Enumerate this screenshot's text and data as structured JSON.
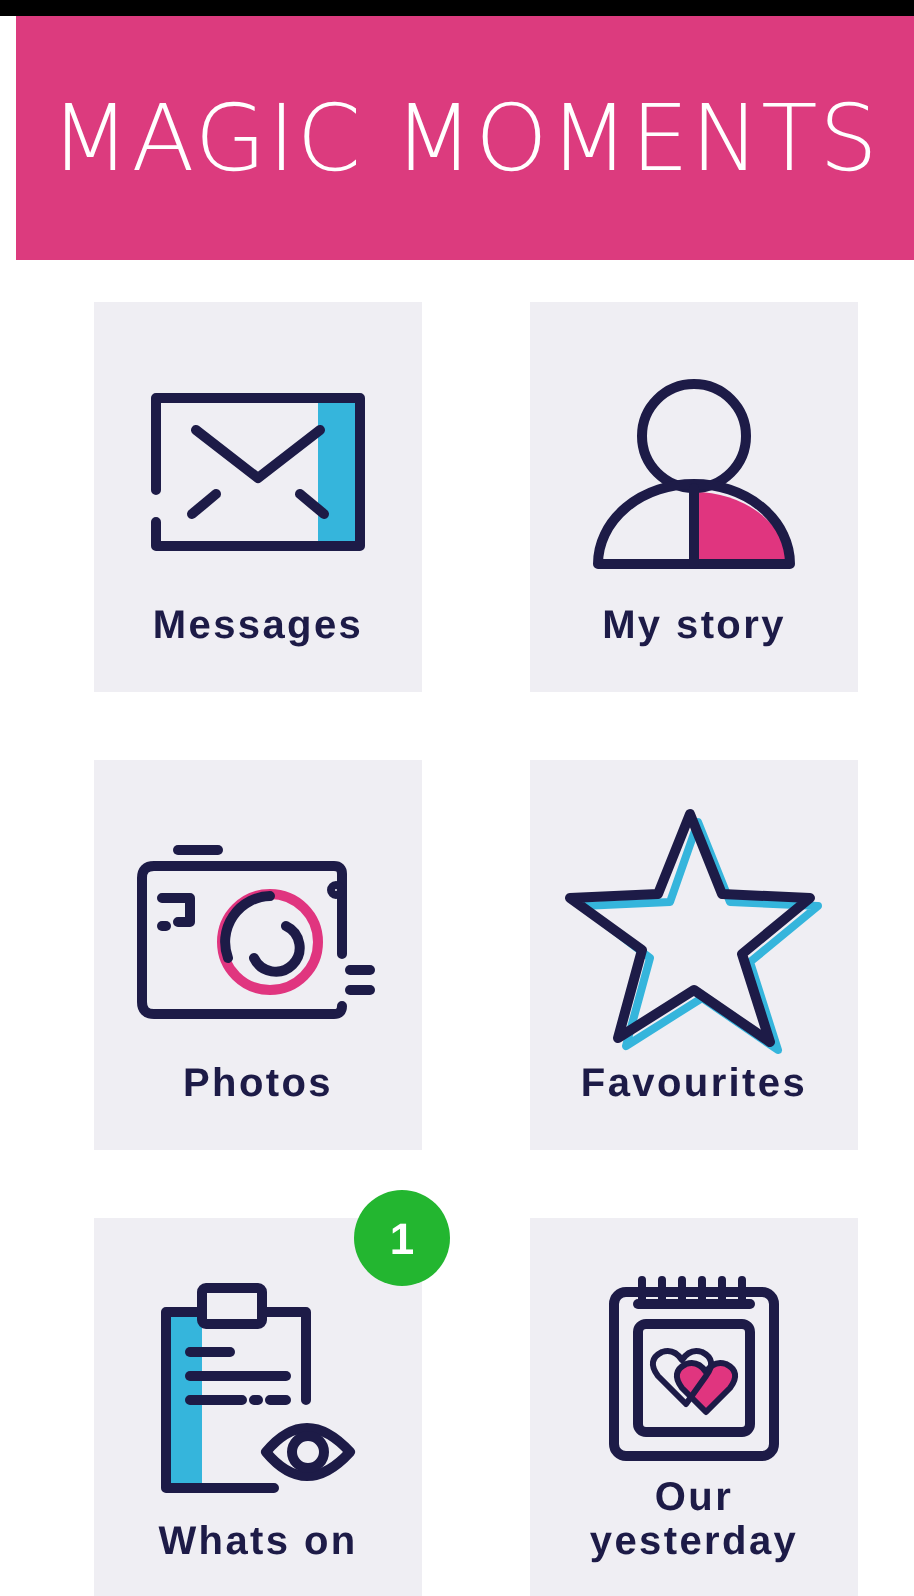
{
  "header": {
    "title": "MAGIC MOMENTS"
  },
  "tiles": [
    {
      "label": "Messages",
      "kind": "envelope"
    },
    {
      "label": "My story",
      "kind": "person"
    },
    {
      "label": "Photos",
      "kind": "camera"
    },
    {
      "label": "Favourites",
      "kind": "star"
    },
    {
      "label": "Whats on",
      "kind": "clipboard",
      "badge": "1"
    },
    {
      "label": "Our yesterday",
      "kind": "calendar"
    }
  ]
}
